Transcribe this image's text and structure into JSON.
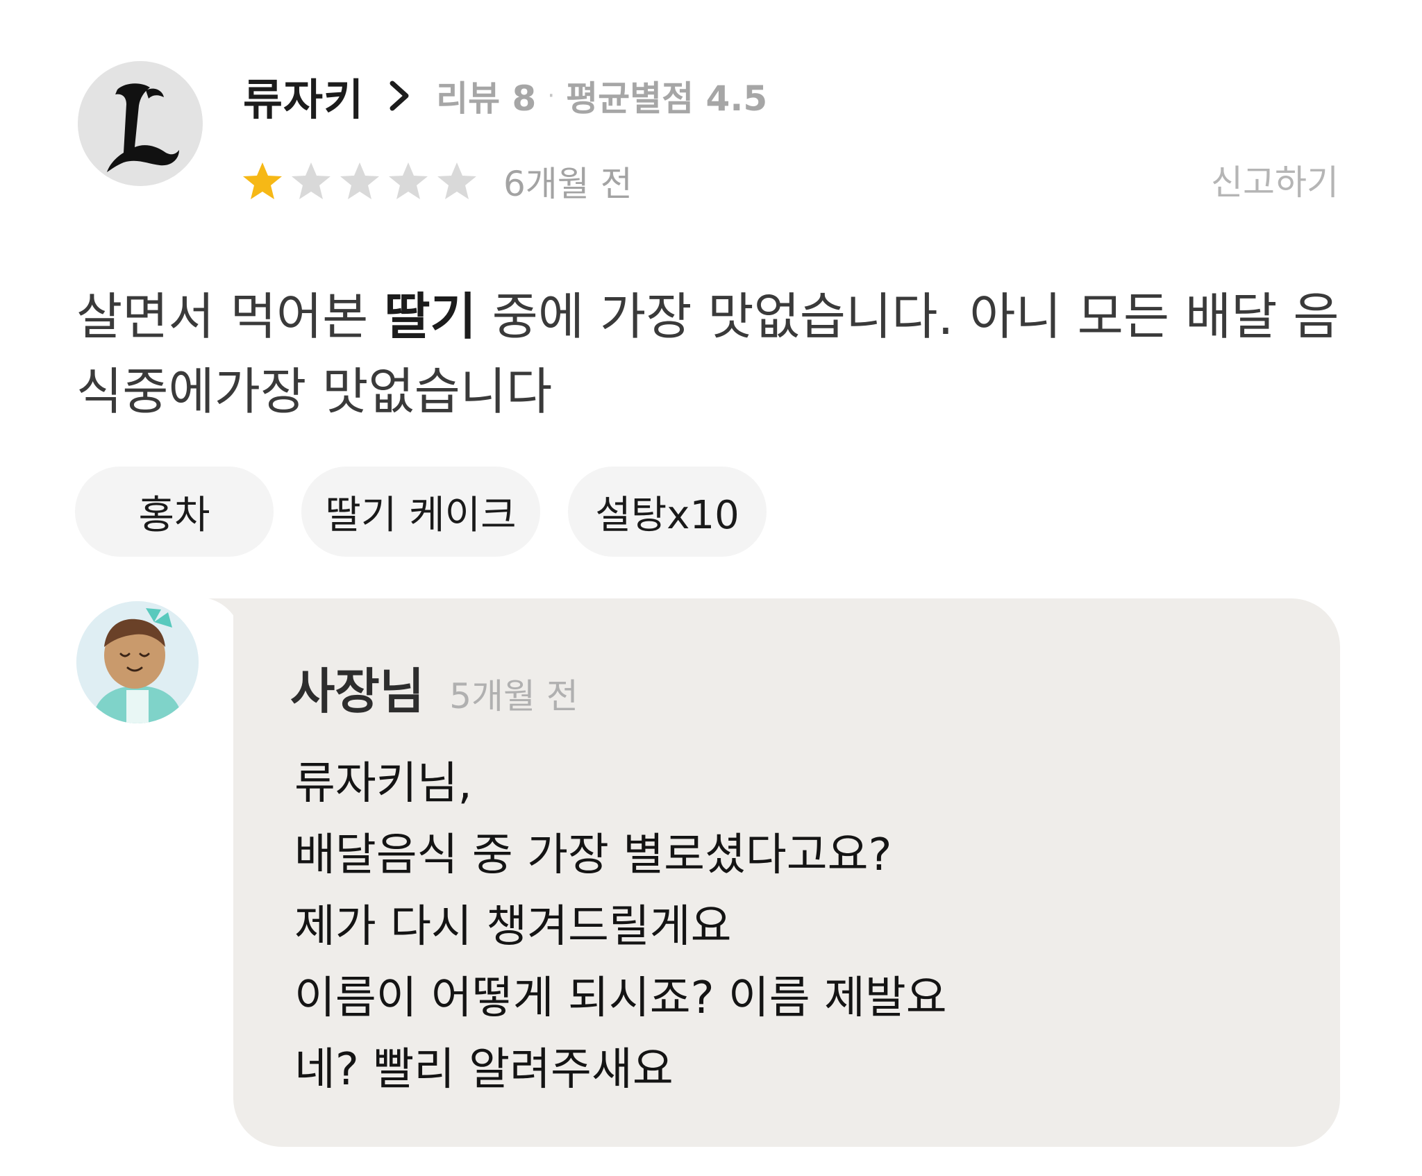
{
  "reviewer": {
    "name": "류자키",
    "review_count": "리뷰 8",
    "separator": "·",
    "avg_rating": "평균별점 4.5",
    "rating": 1,
    "rating_max": 5,
    "date": "6개월 전",
    "report_label": "신고하기"
  },
  "review": {
    "segments": [
      {
        "text": "살면서 먹어본 ",
        "emphasis": false
      },
      {
        "text": "딸기",
        "emphasis": true
      },
      {
        "text": " 중에 가장 맛없습니다. 아니 모든 배달 음식중에가장 맛없습니다",
        "emphasis": false
      }
    ]
  },
  "menu_items": [
    {
      "label": "홍차"
    },
    {
      "label": "딸기 케이크"
    },
    {
      "label": "설탕x10"
    }
  ],
  "reply": {
    "author": "사장님",
    "date": "5개월 전",
    "lines": [
      "류자키님,",
      "배달음식 중 가장 별로셨다고요?",
      "제가 다시 챙겨드릴게요",
      "이름이 어떻게 되시죠? 이름 제발요",
      "네? 빨리 알려주새요"
    ]
  },
  "colors": {
    "star_filled": "#f6b816",
    "star_empty": "#d9d9d9",
    "chip_bg": "#f4f4f4",
    "reply_bg": "#efedea",
    "muted_text": "#a6a6a6"
  },
  "icons": {
    "reviewer_avatar": "gothic-letter-l-avatar",
    "owner_avatar": "cartoon-character-avatar",
    "chevron": "chevron-right-icon",
    "star": "star-icon"
  }
}
